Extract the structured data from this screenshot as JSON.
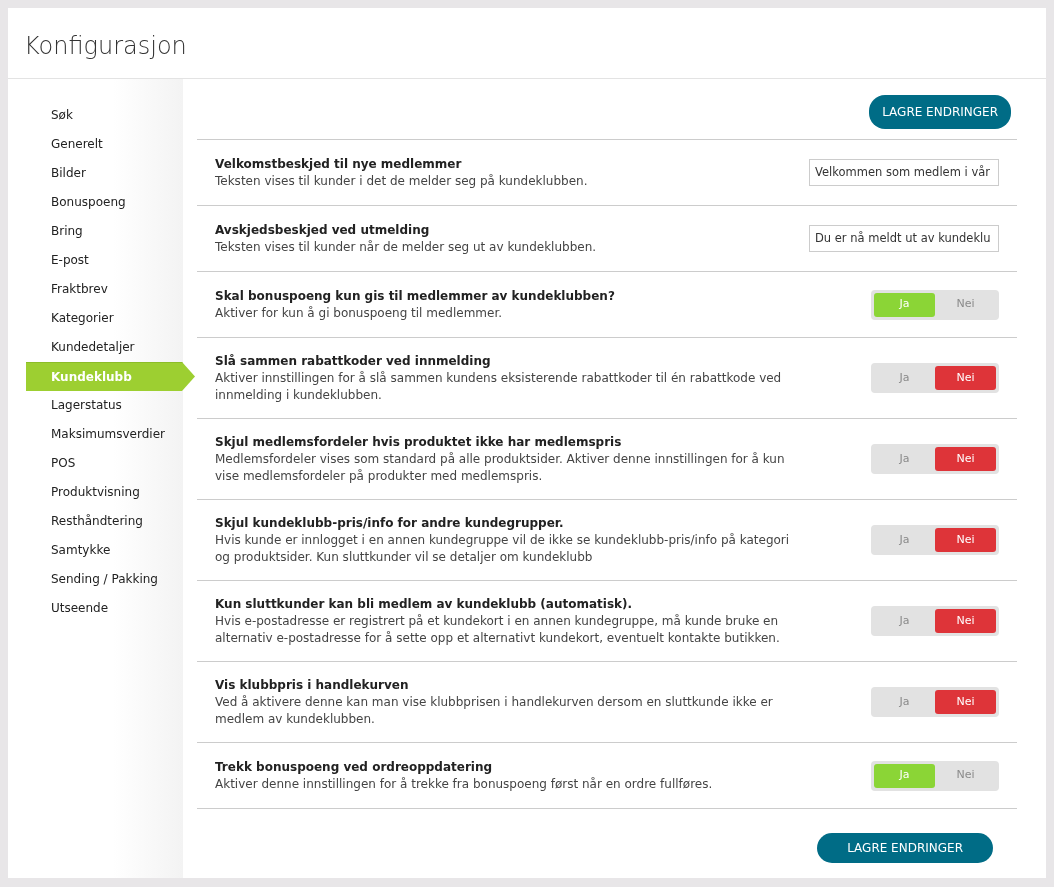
{
  "page_title": "Konfigurasjon",
  "sidebar": {
    "items": [
      {
        "label": "Søk",
        "selected": false
      },
      {
        "label": "Generelt",
        "selected": false
      },
      {
        "label": "Bilder",
        "selected": false
      },
      {
        "label": "Bonuspoeng",
        "selected": false
      },
      {
        "label": "Bring",
        "selected": false
      },
      {
        "label": "E-post",
        "selected": false
      },
      {
        "label": "Fraktbrev",
        "selected": false
      },
      {
        "label": "Kategorier",
        "selected": false
      },
      {
        "label": "Kundedetaljer",
        "selected": false
      },
      {
        "label": "Kundeklubb",
        "selected": true
      },
      {
        "label": "Lagerstatus",
        "selected": false
      },
      {
        "label": "Maksimumsverdier",
        "selected": false
      },
      {
        "label": "POS",
        "selected": false
      },
      {
        "label": "Produktvisning",
        "selected": false
      },
      {
        "label": "Resthåndtering",
        "selected": false
      },
      {
        "label": "Samtykke",
        "selected": false
      },
      {
        "label": "Sending / Pakking",
        "selected": false
      },
      {
        "label": "Utseende",
        "selected": false
      }
    ]
  },
  "save_button_top": "LAGRE ENDRINGER",
  "settings": [
    {
      "kind": "text",
      "title": "Velkomstbeskjed til nye medlemmer",
      "description": "Teksten vises til kunder i det de melder seg på kundeklubben.",
      "value": "Velkommen som medlem i vår"
    },
    {
      "kind": "text",
      "title": "Avskjedsbeskjed ved utmelding",
      "description": "Teksten vises til kunder når de melder seg ut av kundeklubben.",
      "value": "Du er nå meldt ut av kundeklu"
    },
    {
      "kind": "toggle",
      "title": "Skal bonuspoeng kun gis til medlemmer av kundeklubben?",
      "description": "Aktiver for kun å gi bonuspoeng til medlemmer.",
      "options": [
        {
          "label": "Ja",
          "selected": true
        },
        {
          "label": "Nei",
          "selected": false
        }
      ]
    },
    {
      "kind": "toggle",
      "title": "Slå sammen rabattkoder ved innmelding",
      "description": "Aktiver innstillingen for å slå sammen kundens eksisterende rabattkoder til én rabattkode ved innmelding i kundeklubben.",
      "options": [
        {
          "label": "Ja",
          "selected": false
        },
        {
          "label": "Nei",
          "selected": true
        }
      ]
    },
    {
      "kind": "toggle",
      "title": "Skjul medlemsfordeler hvis produktet ikke har medlemspris",
      "description": "Medlemsfordeler vises som standard på alle produktsider. Aktiver denne innstillingen for å kun vise medlemsfordeler på produkter med medlemspris.",
      "options": [
        {
          "label": "Ja",
          "selected": false
        },
        {
          "label": "Nei",
          "selected": true
        }
      ]
    },
    {
      "kind": "toggle",
      "title": "Skjul kundeklubb-pris/info for andre kundegrupper.",
      "description": "Hvis kunde er innlogget i en annen kundegruppe vil de ikke se kundeklubb-pris/info på kategori og produktsider. Kun sluttkunder vil se detaljer om kundeklubb",
      "options": [
        {
          "label": "Ja",
          "selected": false
        },
        {
          "label": "Nei",
          "selected": true
        }
      ]
    },
    {
      "kind": "toggle",
      "title": "Kun sluttkunder kan bli medlem av kundeklubb (automatisk).",
      "description": "Hvis e-postadresse er registrert på et kundekort i en annen kundegruppe, må kunde bruke en alternativ e-postadresse for å sette opp et alternativt kundekort, eventuelt kontakte butikken.",
      "options": [
        {
          "label": "Ja",
          "selected": false
        },
        {
          "label": "Nei",
          "selected": true
        }
      ]
    },
    {
      "kind": "toggle",
      "title": "Vis klubbpris i handlekurven",
      "description": "Ved å aktivere denne kan man vise klubbprisen i handlekurven dersom en sluttkunde ikke er medlem av kundeklubben.",
      "options": [
        {
          "label": "Ja",
          "selected": false
        },
        {
          "label": "Nei",
          "selected": true
        }
      ]
    },
    {
      "kind": "toggle",
      "title": "Trekk bonuspoeng ved ordreoppdatering",
      "description": "Aktiver denne innstillingen for å trekke fra bonuspoeng først når en ordre fullføres.",
      "options": [
        {
          "label": "Ja",
          "selected": true
        },
        {
          "label": "Nei",
          "selected": false
        }
      ]
    }
  ],
  "save_button_bottom": "LAGRE ENDRINGER"
}
